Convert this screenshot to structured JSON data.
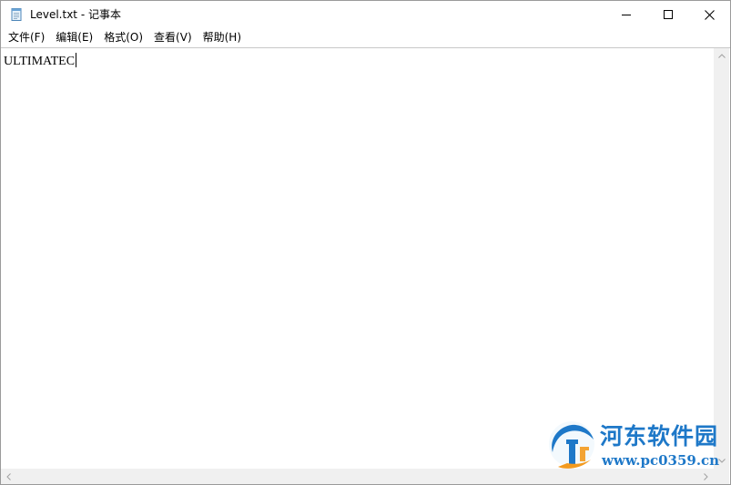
{
  "window": {
    "title": "Level.txt - 记事本"
  },
  "menu": {
    "items": [
      {
        "label": "文件(F)"
      },
      {
        "label": "编辑(E)"
      },
      {
        "label": "格式(O)"
      },
      {
        "label": "查看(V)"
      },
      {
        "label": "帮助(H)"
      }
    ]
  },
  "editor": {
    "content": "ULTIMATEC"
  },
  "watermark": {
    "title": "河东软件园",
    "url": "www.pc0359.cn",
    "logo_icon": "pc0359-logo-icon"
  },
  "colors": {
    "watermark_blue": "#1e78c8",
    "watermark_orange": "#f39a1e",
    "close_hover": "#e81123"
  }
}
